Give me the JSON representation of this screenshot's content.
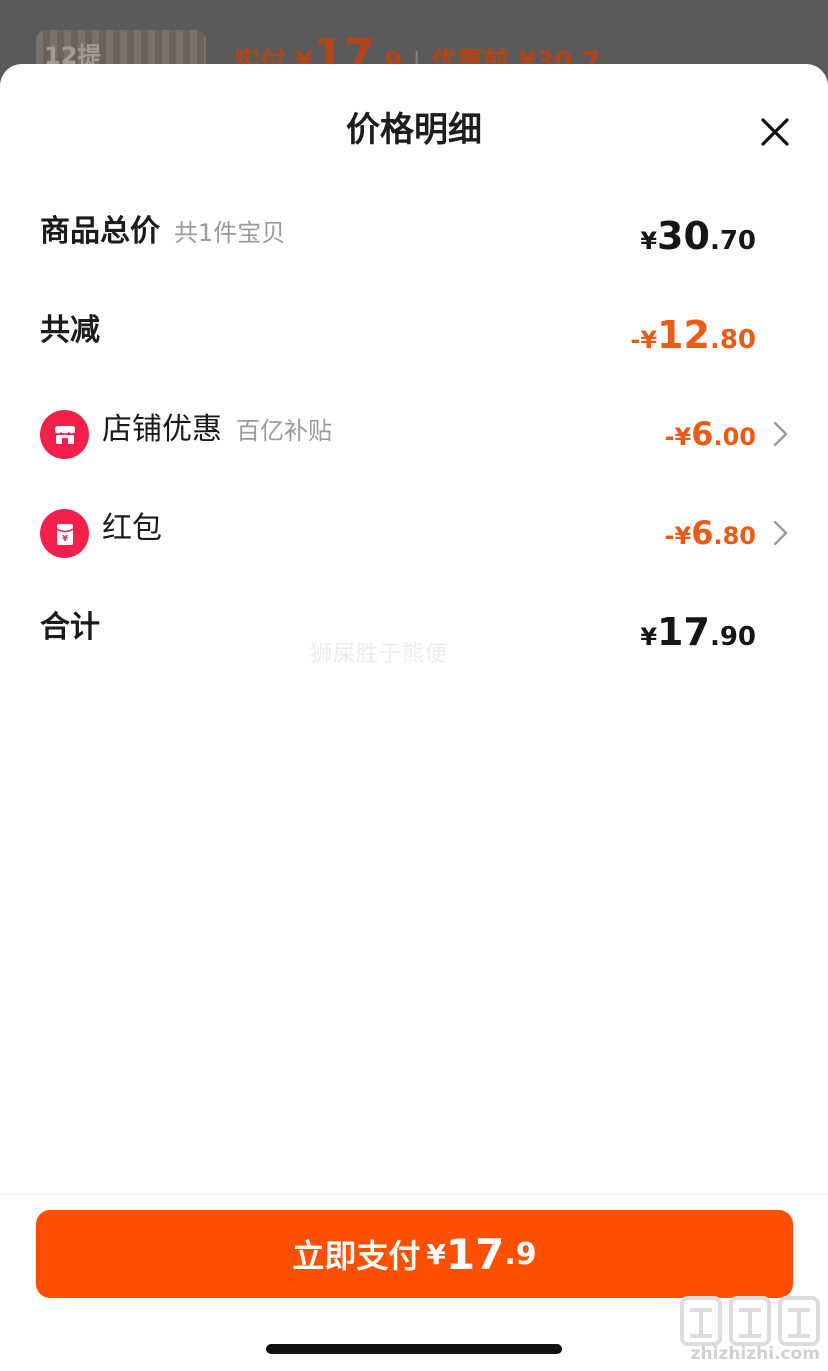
{
  "background": {
    "thumb_label": "12提",
    "price_prefix": "实付 ¥",
    "price_int": "17",
    "price_dec": ".9",
    "separator": "|",
    "original_price": "优惠前 ¥30.7"
  },
  "sheet": {
    "title": "价格明细",
    "close_icon": "close-icon"
  },
  "rows": {
    "subtotal": {
      "label": "商品总价",
      "sub": "共1件宝贝",
      "cur": "¥",
      "int": "30",
      "dec": ".70"
    },
    "discount_total": {
      "label": "共减",
      "cur": "-¥",
      "int": "12",
      "dec": ".80"
    },
    "store_coupon": {
      "label": "店铺优惠",
      "sub": "百亿补贴",
      "cur": "-¥",
      "int": "6",
      "dec": ".00",
      "icon": "store-icon"
    },
    "red_packet": {
      "label": "红包",
      "cur": "-¥",
      "int": "6",
      "dec": ".80",
      "icon": "red-packet-icon"
    },
    "total": {
      "label": "合计",
      "cur": "¥",
      "int": "17",
      "dec": ".90"
    }
  },
  "watermark": "狮屎胜于熊便",
  "pay_button": {
    "text": "立即支付",
    "cur": "¥",
    "int": "17",
    "dec": ".9"
  },
  "site": {
    "text": "zhizhizhi.com"
  },
  "colors": {
    "accent": "#ff5000",
    "discount": "#ec5b14",
    "icon_red": "#f2204a"
  }
}
